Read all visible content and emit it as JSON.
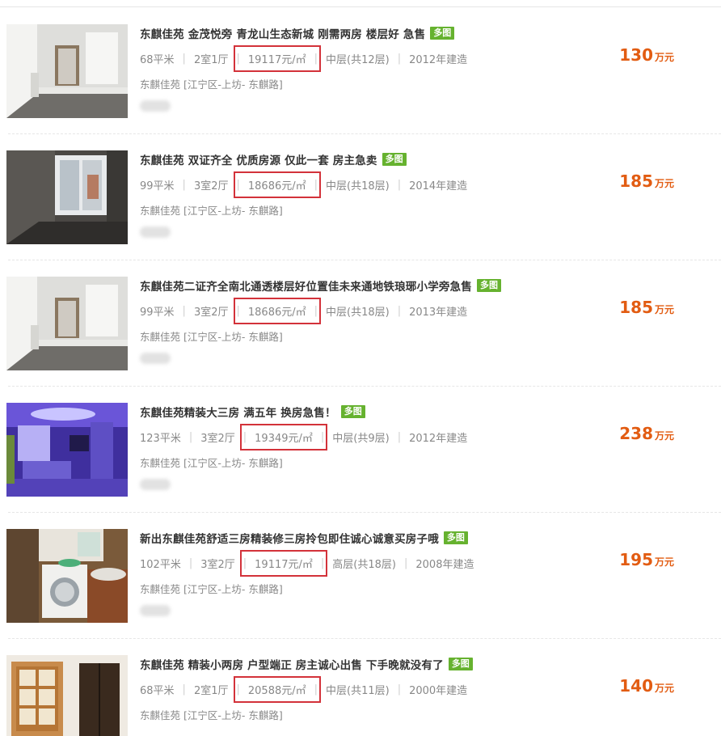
{
  "listings": [
    {
      "title": "东麒佳苑 金茂悦旁 青龙山生态新城 刚需两房 楼层好 急售",
      "badge": "多图",
      "area": "68平米",
      "layout": "2室1厅",
      "unit_price": "19117元/㎡",
      "floor": "中层(共12层)",
      "built": "2012年建造",
      "address": "东麒佳苑 [江宁区-上坊- 东麒路]",
      "price_value": "130",
      "price_unit": "万元"
    },
    {
      "title": "东麒佳苑 双证齐全 优质房源 仅此一套 房主急卖",
      "badge": "多图",
      "area": "99平米",
      "layout": "3室2厅",
      "unit_price": "18686元/㎡",
      "floor": "中层(共18层)",
      "built": "2014年建造",
      "address": "东麒佳苑 [江宁区-上坊- 东麒路]",
      "price_value": "185",
      "price_unit": "万元"
    },
    {
      "title": "东麒佳苑二证齐全南北通透楼层好位置佳未来通地铁琅琊小学旁急售",
      "badge": "多图",
      "area": "99平米",
      "layout": "3室2厅",
      "unit_price": "18686元/㎡",
      "floor": "中层(共18层)",
      "built": "2013年建造",
      "address": "东麒佳苑 [江宁区-上坊- 东麒路]",
      "price_value": "185",
      "price_unit": "万元"
    },
    {
      "title": "东麒佳苑精装大三房 满五年 换房急售！",
      "badge": "多图",
      "area": "123平米",
      "layout": "3室2厅",
      "unit_price": "19349元/㎡",
      "floor": "中层(共9层)",
      "built": "2012年建造",
      "address": "东麒佳苑 [江宁区-上坊- 东麒路]",
      "price_value": "238",
      "price_unit": "万元"
    },
    {
      "title": "新出东麒佳苑舒适三房精装修三房拎包即住诚心诚意买房子哦",
      "badge": "多图",
      "area": "102平米",
      "layout": "3室2厅",
      "unit_price": "19117元/㎡",
      "floor": "高层(共18层)",
      "built": "2008年建造",
      "address": "东麒佳苑 [江宁区-上坊- 东麒路]",
      "price_value": "195",
      "price_unit": "万元"
    },
    {
      "title": "东麒佳苑 精装小两房 户型端正 房主诚心出售 下手晚就没有了",
      "badge": "多图",
      "area": "68平米",
      "layout": "2室1厅",
      "unit_price": "20588元/㎡",
      "floor": "中层(共11层)",
      "built": "2000年建造",
      "address": "东麒佳苑 [江宁区-上坊- 东麒路]",
      "price_value": "140",
      "price_unit": "万元"
    }
  ],
  "colors": {
    "price": "#e25c12",
    "badge_bg": "#66b22f",
    "highlight_box": "#d3323a",
    "meta_text": "#888888",
    "title_text": "#333333"
  }
}
